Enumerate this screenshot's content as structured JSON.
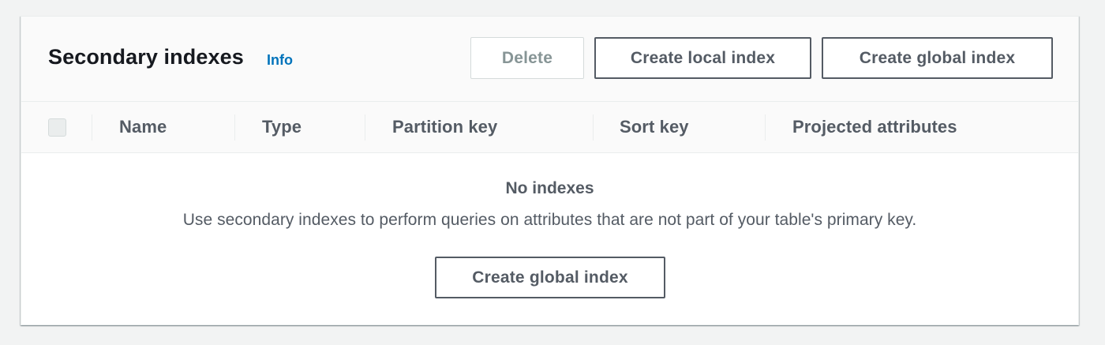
{
  "panel": {
    "title": "Secondary indexes",
    "info_label": "Info",
    "actions": {
      "delete_label": "Delete",
      "create_local_label": "Create local index",
      "create_global_label": "Create global index"
    }
  },
  "table": {
    "columns": [
      "Name",
      "Type",
      "Partition key",
      "Sort key",
      "Projected attributes"
    ],
    "select_all_checked": false
  },
  "empty_state": {
    "title": "No indexes",
    "description": "Use secondary indexes to perform queries on attributes that are not part of your table's primary key.",
    "action_label": "Create global index"
  },
  "colors": {
    "link": "#0073bb",
    "text": "#16191f",
    "muted": "#545b64",
    "disabled": "#879596"
  }
}
